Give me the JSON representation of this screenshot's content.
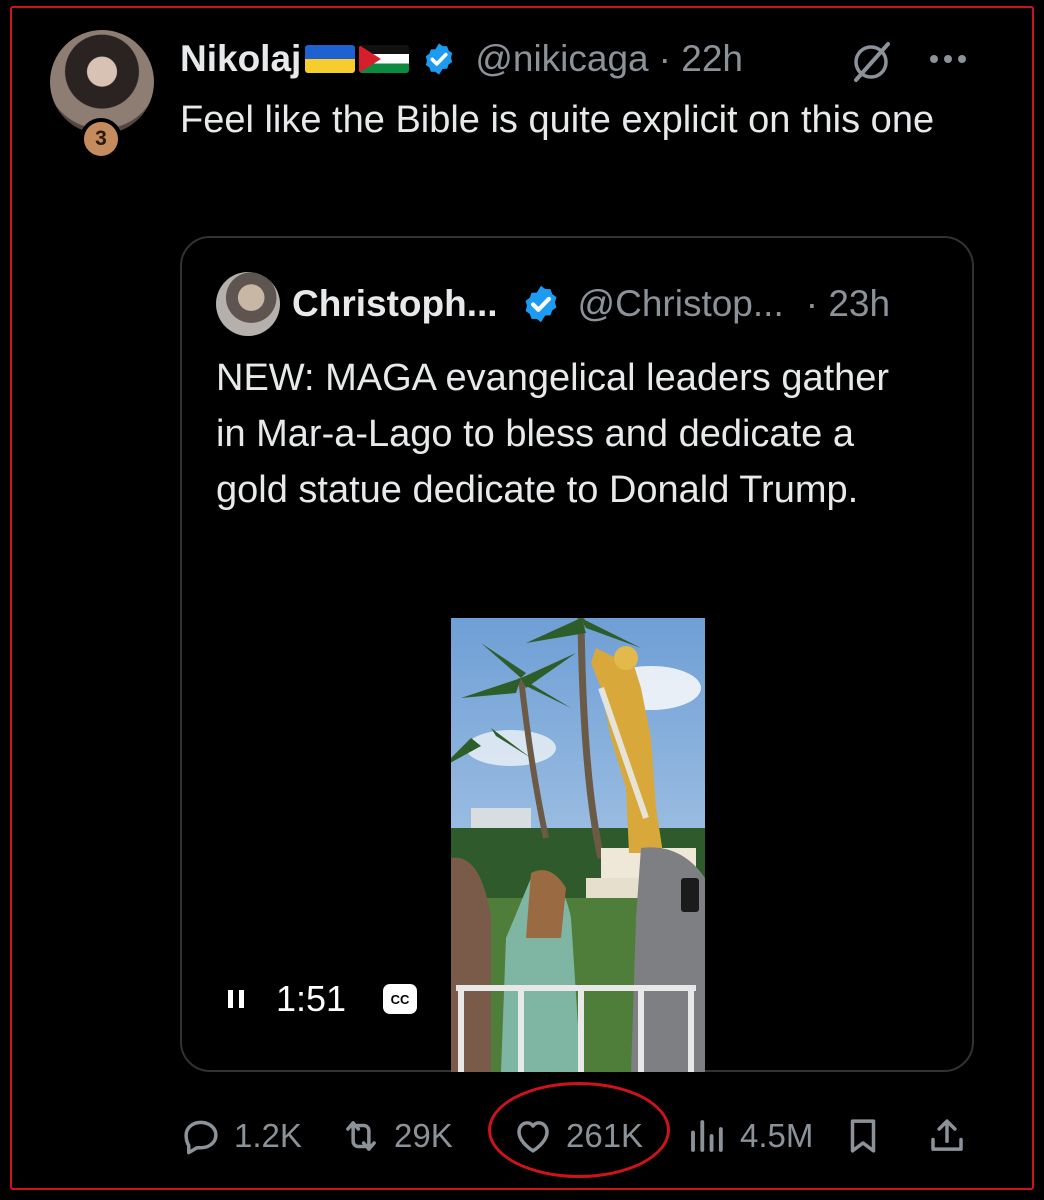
{
  "tweet": {
    "display_name": "Nikolaj",
    "handle": "@nikicaga",
    "time": "· 22h",
    "avatar_badge": "3",
    "text": "Feel like the Bible is quite explicit on this one"
  },
  "quote": {
    "display_name": "Christoph...",
    "handle": "@Christop...",
    "time": "· 23h",
    "text": "NEW: MAGA evangelical leaders gather in Mar-a-Lago to bless and dedicate a gold statue dedicate to Donald Trump.",
    "video": {
      "duration": "1:51",
      "cc_label": "CC"
    }
  },
  "actions": {
    "replies": "1.2K",
    "reposts": "29K",
    "likes": "261K",
    "views": "4.5M"
  },
  "colors": {
    "accent_blue": "#1d9bf0",
    "highlight_red": "#d0121b",
    "text_secondary": "#8b9298"
  },
  "icons": [
    "verified-icon",
    "grok-icon",
    "more-icon",
    "pause-icon",
    "cc-icon",
    "reply-icon",
    "repost-icon",
    "like-icon",
    "views-icon",
    "bookmark-icon",
    "share-icon"
  ]
}
